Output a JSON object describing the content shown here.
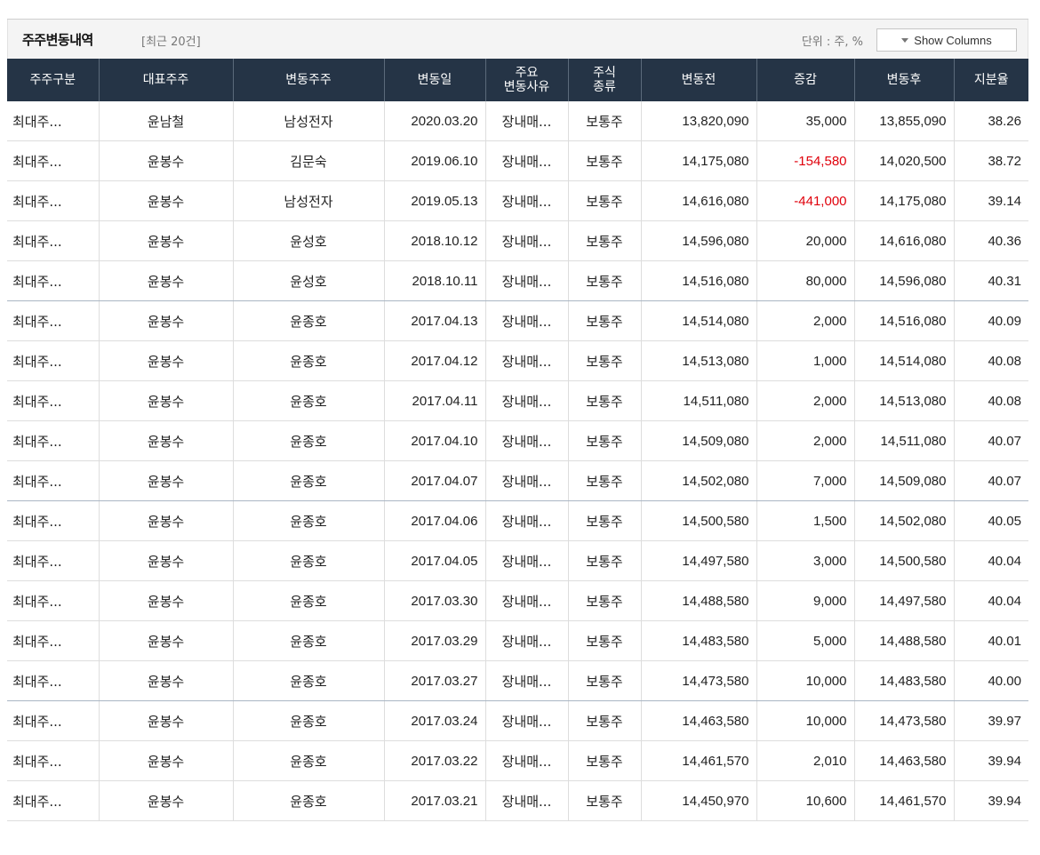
{
  "toolbar": {
    "title": "주주변동내역",
    "count": "[최근 20건]",
    "unit": "단위 : 주, %",
    "show_columns": "Show Columns"
  },
  "table": {
    "columns": [
      {
        "lines": [
          "주주구분"
        ]
      },
      {
        "lines": [
          "대표주주"
        ]
      },
      {
        "lines": [
          "변동주주"
        ]
      },
      {
        "lines": [
          "변동일"
        ]
      },
      {
        "lines": [
          "주요",
          "변동사유"
        ]
      },
      {
        "lines": [
          "주식",
          "종류"
        ]
      },
      {
        "lines": [
          "변동전"
        ]
      },
      {
        "lines": [
          "증감"
        ]
      },
      {
        "lines": [
          "변동후"
        ]
      },
      {
        "lines": [
          "지분율"
        ]
      }
    ],
    "rows": [
      {
        "type": "최대주...",
        "rep": "윤남철",
        "holder": "남성전자",
        "date": "2020.03.20",
        "reason": "장내매...",
        "kind": "보통주",
        "before": "13,820,090",
        "change": "35,000",
        "negative": false,
        "after": "13,855,090",
        "ratio": "38.26"
      },
      {
        "type": "최대주...",
        "rep": "윤봉수",
        "holder": "김문숙",
        "date": "2019.06.10",
        "reason": "장내매...",
        "kind": "보통주",
        "before": "14,175,080",
        "change": "-154,580",
        "negative": true,
        "after": "14,020,500",
        "ratio": "38.72"
      },
      {
        "type": "최대주...",
        "rep": "윤봉수",
        "holder": "남성전자",
        "date": "2019.05.13",
        "reason": "장내매...",
        "kind": "보통주",
        "before": "14,616,080",
        "change": "-441,000",
        "negative": true,
        "after": "14,175,080",
        "ratio": "39.14"
      },
      {
        "type": "최대주...",
        "rep": "윤봉수",
        "holder": "윤성호",
        "date": "2018.10.12",
        "reason": "장내매...",
        "kind": "보통주",
        "before": "14,596,080",
        "change": "20,000",
        "negative": false,
        "after": "14,616,080",
        "ratio": "40.36"
      },
      {
        "type": "최대주...",
        "rep": "윤봉수",
        "holder": "윤성호",
        "date": "2018.10.11",
        "reason": "장내매...",
        "kind": "보통주",
        "before": "14,516,080",
        "change": "80,000",
        "negative": false,
        "after": "14,596,080",
        "ratio": "40.31"
      },
      {
        "type": "최대주...",
        "rep": "윤봉수",
        "holder": "윤종호",
        "date": "2017.04.13",
        "reason": "장내매...",
        "kind": "보통주",
        "before": "14,514,080",
        "change": "2,000",
        "negative": false,
        "after": "14,516,080",
        "ratio": "40.09"
      },
      {
        "type": "최대주...",
        "rep": "윤봉수",
        "holder": "윤종호",
        "date": "2017.04.12",
        "reason": "장내매...",
        "kind": "보통주",
        "before": "14,513,080",
        "change": "1,000",
        "negative": false,
        "after": "14,514,080",
        "ratio": "40.08"
      },
      {
        "type": "최대주...",
        "rep": "윤봉수",
        "holder": "윤종호",
        "date": "2017.04.11",
        "reason": "장내매...",
        "kind": "보통주",
        "before": "14,511,080",
        "change": "2,000",
        "negative": false,
        "after": "14,513,080",
        "ratio": "40.08"
      },
      {
        "type": "최대주...",
        "rep": "윤봉수",
        "holder": "윤종호",
        "date": "2017.04.10",
        "reason": "장내매...",
        "kind": "보통주",
        "before": "14,509,080",
        "change": "2,000",
        "negative": false,
        "after": "14,511,080",
        "ratio": "40.07"
      },
      {
        "type": "최대주...",
        "rep": "윤봉수",
        "holder": "윤종호",
        "date": "2017.04.07",
        "reason": "장내매...",
        "kind": "보통주",
        "before": "14,502,080",
        "change": "7,000",
        "negative": false,
        "after": "14,509,080",
        "ratio": "40.07"
      },
      {
        "type": "최대주...",
        "rep": "윤봉수",
        "holder": "윤종호",
        "date": "2017.04.06",
        "reason": "장내매...",
        "kind": "보통주",
        "before": "14,500,580",
        "change": "1,500",
        "negative": false,
        "after": "14,502,080",
        "ratio": "40.05"
      },
      {
        "type": "최대주...",
        "rep": "윤봉수",
        "holder": "윤종호",
        "date": "2017.04.05",
        "reason": "장내매...",
        "kind": "보통주",
        "before": "14,497,580",
        "change": "3,000",
        "negative": false,
        "after": "14,500,580",
        "ratio": "40.04"
      },
      {
        "type": "최대주...",
        "rep": "윤봉수",
        "holder": "윤종호",
        "date": "2017.03.30",
        "reason": "장내매...",
        "kind": "보통주",
        "before": "14,488,580",
        "change": "9,000",
        "negative": false,
        "after": "14,497,580",
        "ratio": "40.04"
      },
      {
        "type": "최대주...",
        "rep": "윤봉수",
        "holder": "윤종호",
        "date": "2017.03.29",
        "reason": "장내매...",
        "kind": "보통주",
        "before": "14,483,580",
        "change": "5,000",
        "negative": false,
        "after": "14,488,580",
        "ratio": "40.01"
      },
      {
        "type": "최대주...",
        "rep": "윤봉수",
        "holder": "윤종호",
        "date": "2017.03.27",
        "reason": "장내매...",
        "kind": "보통주",
        "before": "14,473,580",
        "change": "10,000",
        "negative": false,
        "after": "14,483,580",
        "ratio": "40.00"
      },
      {
        "type": "최대주...",
        "rep": "윤봉수",
        "holder": "윤종호",
        "date": "2017.03.24",
        "reason": "장내매...",
        "kind": "보통주",
        "before": "14,463,580",
        "change": "10,000",
        "negative": false,
        "after": "14,473,580",
        "ratio": "39.97"
      },
      {
        "type": "최대주...",
        "rep": "윤봉수",
        "holder": "윤종호",
        "date": "2017.03.22",
        "reason": "장내매...",
        "kind": "보통주",
        "before": "14,461,570",
        "change": "2,010",
        "negative": false,
        "after": "14,463,580",
        "ratio": "39.94"
      },
      {
        "type": "최대주...",
        "rep": "윤봉수",
        "holder": "윤종호",
        "date": "2017.03.21",
        "reason": "장내매...",
        "kind": "보통주",
        "before": "14,450,970",
        "change": "10,600",
        "negative": false,
        "after": "14,461,570",
        "ratio": "39.94"
      }
    ]
  },
  "colors": {
    "header_bg": "#253446",
    "negative": "#e0000b",
    "toolbar_bg": "#f4f4f4"
  },
  "icons": {
    "show_columns": "caret-down-icon"
  }
}
